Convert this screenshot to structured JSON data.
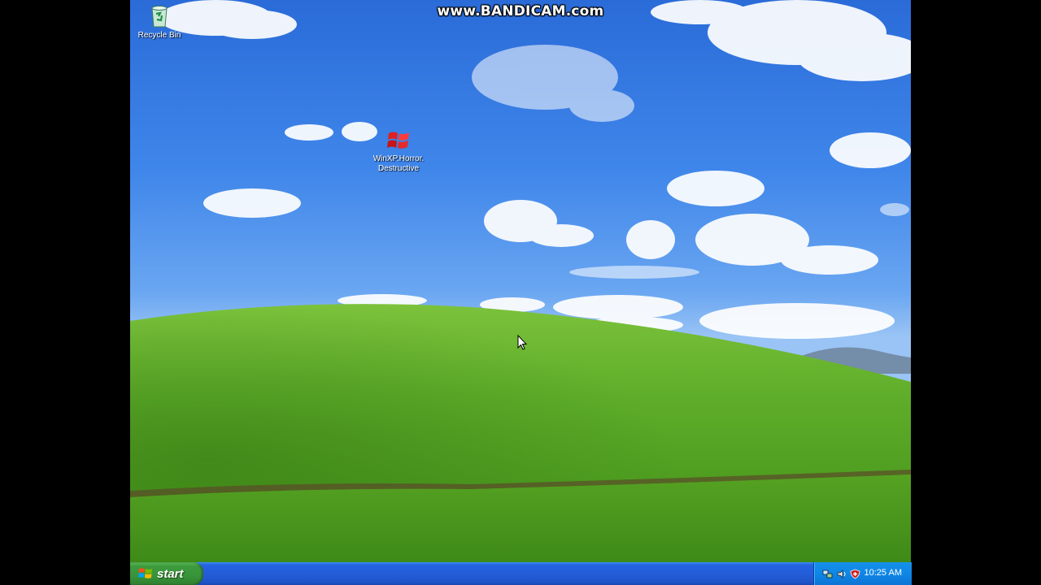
{
  "watermark": "www.BANDICAM.com",
  "desktop": {
    "icons": [
      {
        "label": "Recycle Bin"
      },
      {
        "label_line1": "WinXP.Horror.",
        "label_line2": "Destructive"
      }
    ]
  },
  "taskbar": {
    "start_label": "start",
    "tray": {
      "icons": [
        "network-icon",
        "speaker-icon",
        "security-shield-icon"
      ],
      "clock": "10:25 AM"
    }
  },
  "colors": {
    "sky": "#2a6bd8",
    "grass": "#5fae2a",
    "taskbar": "#245dd8",
    "start_button": "#3d9a3d",
    "tray": "#0f87e6"
  }
}
